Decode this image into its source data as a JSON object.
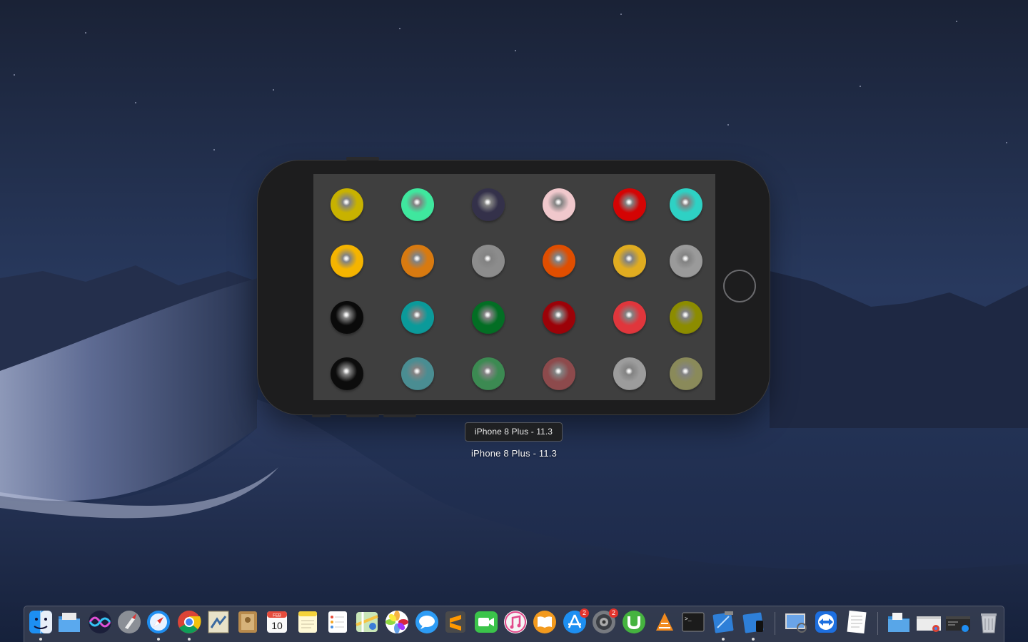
{
  "simulator": {
    "device_label": "iPhone 8 Plus - 11.3",
    "tooltip": "iPhone 8 Plus - 11.3",
    "screen_bg": "#3f3f3f",
    "balls": [
      [
        {
          "color": "#c8b200"
        },
        {
          "color": "#3fe79e"
        },
        {
          "color": "#34314a"
        },
        {
          "color": "#f0c8cc"
        },
        {
          "color": "#d40404"
        },
        {
          "color": "#2ed1c4"
        }
      ],
      [
        {
          "color": "#f5b400"
        },
        {
          "color": "#d87a10"
        },
        {
          "color": "#8c8c8c"
        },
        {
          "color": "#e04e00"
        },
        {
          "color": "#e0ac20"
        },
        {
          "color": "#9a9a9a"
        }
      ],
      [
        {
          "color": "#0a0a0a"
        },
        {
          "color": "#0b9a9a"
        },
        {
          "color": "#036e24"
        },
        {
          "color": "#9c0208"
        },
        {
          "color": "#e0363c"
        },
        {
          "color": "#8c8c00"
        }
      ],
      [
        {
          "color": "#0c0c0c"
        },
        {
          "color": "#4a8d92"
        },
        {
          "color": "#3c8a52"
        },
        {
          "color": "#8d4a4c"
        },
        {
          "color": "#9c9c9c"
        },
        {
          "color": "#8a8a5a"
        }
      ]
    ]
  },
  "dock": {
    "items": [
      {
        "name": "finder-icon",
        "running": true,
        "badge": ""
      },
      {
        "name": "file-manager-icon",
        "running": false,
        "badge": ""
      },
      {
        "name": "siri-icon",
        "running": false,
        "badge": ""
      },
      {
        "name": "launchpad-icon",
        "running": false,
        "badge": ""
      },
      {
        "name": "safari-icon",
        "running": true,
        "badge": ""
      },
      {
        "name": "chrome-icon",
        "running": true,
        "badge": ""
      },
      {
        "name": "mail-stamp-icon",
        "running": false,
        "badge": ""
      },
      {
        "name": "contacts-icon",
        "running": false,
        "badge": ""
      },
      {
        "name": "calendar-icon",
        "running": false,
        "badge": "",
        "month": "FEB",
        "day": "10"
      },
      {
        "name": "notes-icon",
        "running": false,
        "badge": ""
      },
      {
        "name": "reminders-icon",
        "running": false,
        "badge": ""
      },
      {
        "name": "maps-icon",
        "running": false,
        "badge": ""
      },
      {
        "name": "photos-icon",
        "running": false,
        "badge": ""
      },
      {
        "name": "messages-icon",
        "running": false,
        "badge": ""
      },
      {
        "name": "sublime-text-icon",
        "running": false,
        "badge": ""
      },
      {
        "name": "facetime-icon",
        "running": false,
        "badge": ""
      },
      {
        "name": "itunes-icon",
        "running": false,
        "badge": ""
      },
      {
        "name": "ibooks-icon",
        "running": false,
        "badge": ""
      },
      {
        "name": "app-store-icon",
        "running": false,
        "badge": "2"
      },
      {
        "name": "system-preferences-icon",
        "running": false,
        "badge": "2"
      },
      {
        "name": "utorrent-icon",
        "running": false,
        "badge": ""
      },
      {
        "name": "vlc-cone-icon",
        "running": false,
        "badge": ""
      },
      {
        "name": "terminal-icon",
        "running": false,
        "badge": "",
        "prompt": ">_"
      },
      {
        "name": "xcode-icon",
        "running": true,
        "badge": ""
      },
      {
        "name": "simulator-icon",
        "running": true,
        "badge": ""
      },
      {
        "name": "preview-icon",
        "running": false,
        "badge": ""
      },
      {
        "name": "teamviewer-icon",
        "running": false,
        "badge": ""
      },
      {
        "name": "textedit-icon",
        "running": false,
        "badge": ""
      },
      {
        "name": "documents-folder-icon",
        "running": false,
        "badge": ""
      },
      {
        "name": "chrome-window-icon",
        "running": false,
        "badge": ""
      },
      {
        "name": "safari-window-icon",
        "running": false,
        "badge": ""
      },
      {
        "name": "trash-icon",
        "running": false,
        "badge": ""
      }
    ]
  }
}
